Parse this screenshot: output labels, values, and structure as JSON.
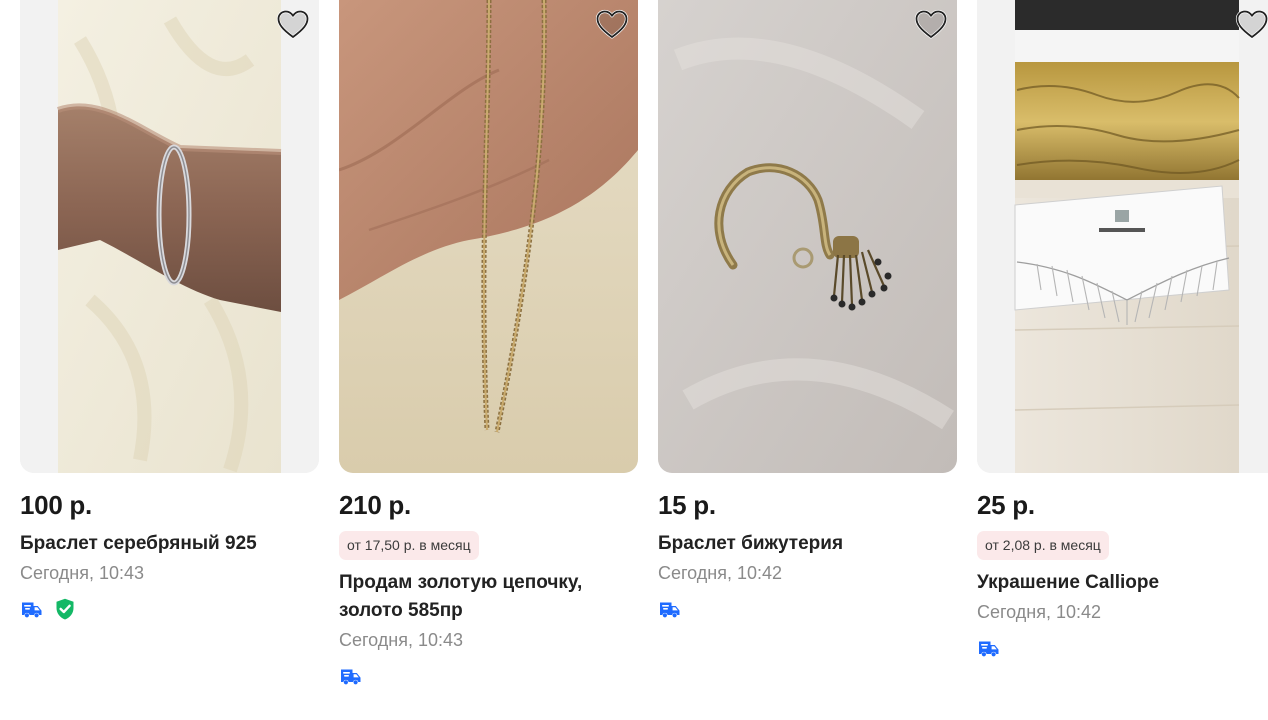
{
  "listings": [
    {
      "price": "100 р.",
      "installment": "",
      "title": "Браслет серебряный 925",
      "date": "Сегодня, 10:43",
      "badges": [
        "delivery-truck-icon",
        "verified-shield-icon"
      ]
    },
    {
      "price": "210 р.",
      "installment": "от 17,50 р. в месяц",
      "title": "Продам золотую цепочку, золото 585пр",
      "date": "Сегодня, 10:43",
      "badges": [
        "delivery-truck-icon"
      ]
    },
    {
      "price": "15 р.",
      "installment": "",
      "title": "Браслет бижутерия",
      "date": "Сегодня, 10:42",
      "badges": [
        "delivery-truck-icon"
      ]
    },
    {
      "price": "25 р.",
      "installment": "от 2,08 р. в месяц",
      "title": "Украшение Calliope",
      "date": "Сегодня, 10:42",
      "badges": [
        "delivery-truck-icon"
      ]
    }
  ],
  "colors": {
    "delivery_icon": "#1f6bff",
    "verified_icon": "#14b866",
    "installment_bg": "#fbe9ea",
    "date_text": "#8a8a8a"
  }
}
